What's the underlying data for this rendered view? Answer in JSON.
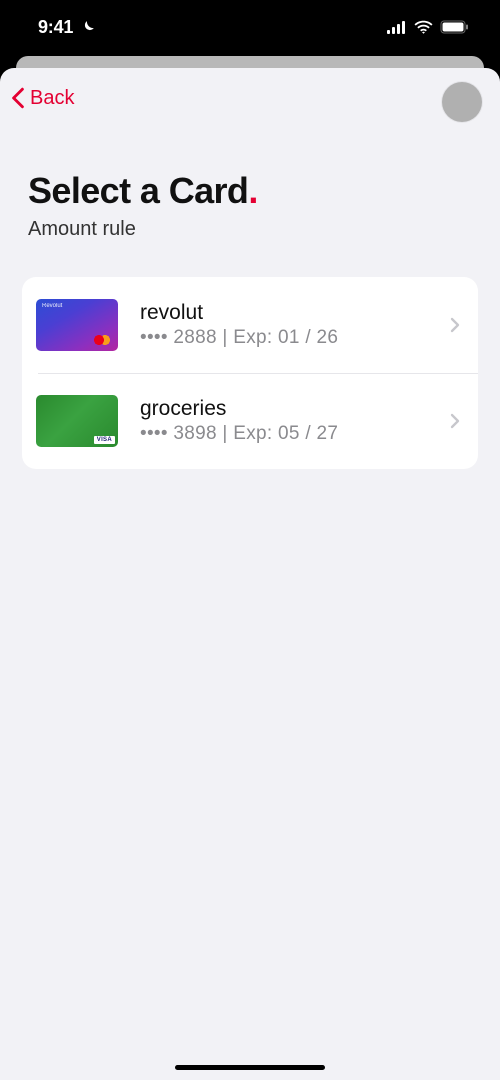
{
  "status_bar": {
    "time": "9:41"
  },
  "nav": {
    "back_label": "Back"
  },
  "header": {
    "title": "Select a Card",
    "dot": ".",
    "subtitle": "Amount rule"
  },
  "cards": [
    {
      "name": "revolut",
      "meta": "•••• 2888 | Exp: 01 / 26"
    },
    {
      "name": "groceries",
      "meta": "•••• 3898 | Exp: 05 / 27"
    }
  ]
}
